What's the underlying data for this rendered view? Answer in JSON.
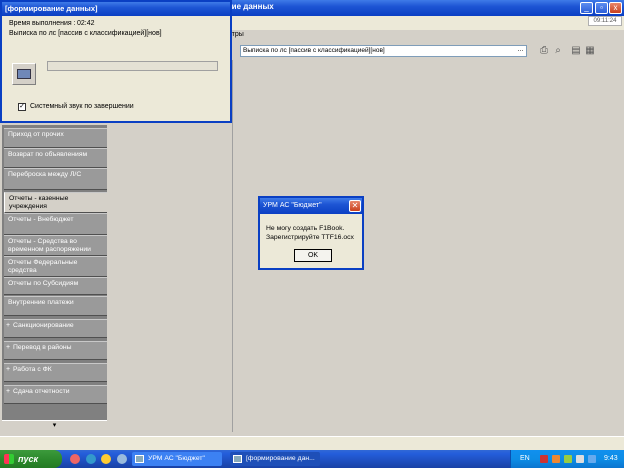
{
  "main_window": {
    "title": "...ие данных",
    "clock": "09:11:24",
    "params_tab": "етры",
    "report_select_value": "Выписка по лс [пассив с классификацией][нов]",
    "report_select_button": "..."
  },
  "sidebar": {
    "items": [
      {
        "label": "Приход от прочих"
      },
      {
        "label": "Возврат по объявлениям"
      },
      {
        "label": "Переброска между Л/С"
      },
      {
        "label": "Отчеты - казенные учреждения"
      },
      {
        "label": "Отчеты - Внебюджет"
      },
      {
        "label": "Отчеты - Средства во временном распоряжении"
      },
      {
        "label": "Отчеты Федеральные средства"
      },
      {
        "label": "Отчеты по Субсидиям"
      },
      {
        "label": "Внутренние платежи"
      },
      {
        "label": "Санкционирование"
      },
      {
        "label": "Перевод в районы"
      },
      {
        "label": "Работа с ФК"
      },
      {
        "label": "Сдача отчетности"
      }
    ],
    "scroll_down": "▾"
  },
  "progress_dialog": {
    "title": "[формирование данных]",
    "time_label": "Время выполнения :",
    "time_value": "02:42",
    "report_name": "Выписка по лс [пассив с классификацией][нов]",
    "progress": 0,
    "sound_checkbox_label": "Системный звук по завершении",
    "sound_checked": true,
    "check_mark": "✓"
  },
  "error_dialog": {
    "title": "УРМ АС \"Бюджет\"",
    "close_glyph": "✕",
    "message_line1": "Не могу создать F1Book.",
    "message_line2": "Зарегистрируйте TTF16.ocx",
    "ok_label": "OK"
  },
  "taskbar": {
    "start_label": "пуск",
    "tasks": [
      {
        "label": "УРМ АС \"Бюджет\""
      },
      {
        "label": "[формирование дан..."
      }
    ],
    "language": "EN",
    "time": "9:43"
  },
  "colors": {
    "title_blue": "#0a3fc3",
    "sidebar_gray": "#808080",
    "start_green": "#2d8a2d"
  }
}
